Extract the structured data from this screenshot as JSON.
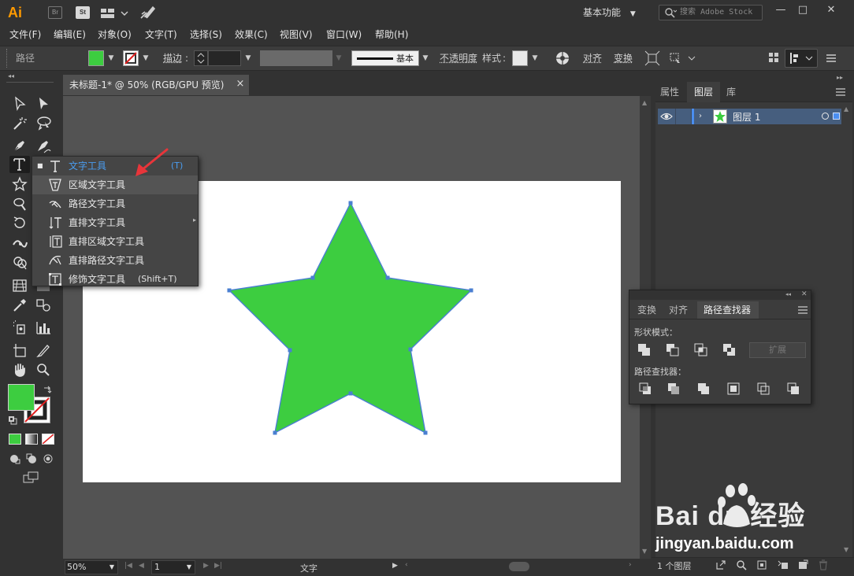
{
  "app": {
    "logo": "Ai",
    "badges": [
      "Br",
      "St"
    ],
    "workspace": "基本功能",
    "search_placeholder": "搜索 Adobe Stock",
    "window_controls": [
      "minimize-icon",
      "maximize-icon",
      "close-icon"
    ]
  },
  "menu": [
    "文件(F)",
    "编辑(E)",
    "对象(O)",
    "文字(T)",
    "选择(S)",
    "效果(C)",
    "视图(V)",
    "窗口(W)",
    "帮助(H)"
  ],
  "control_bar": {
    "object_label": "路径",
    "stroke_label": "描边",
    "stroke_value": "",
    "profile_label": "基本",
    "opacity_label": "不透明度",
    "style_label": "样式",
    "align_label": "对齐",
    "transform_label": "变换",
    "fill_color": "#3dcd40",
    "stroke_color": "none"
  },
  "document": {
    "tab_title": "未标题-1* @ 50% (RGB/GPU 预览)",
    "close_glyph": "×"
  },
  "artwork": {
    "shape": "star",
    "fill_color": "#3dcd40",
    "outline_color": "#4a7fd1"
  },
  "toolbar": {
    "fill_color": "#3dcd40",
    "stroke_color": "none"
  },
  "flyout": {
    "items": [
      {
        "label": "文字工具",
        "shortcut": "(T)",
        "icon": "type-tool-icon",
        "current": true
      },
      {
        "label": "区域文字工具",
        "shortcut": "",
        "icon": "area-type-tool-icon",
        "hover": true
      },
      {
        "label": "路径文字工具",
        "shortcut": "",
        "icon": "type-on-path-tool-icon"
      },
      {
        "label": "直排文字工具",
        "shortcut": "",
        "icon": "vertical-type-tool-icon"
      },
      {
        "label": "直排区域文字工具",
        "shortcut": "",
        "icon": "vertical-area-type-tool-icon"
      },
      {
        "label": "直排路径文字工具",
        "shortcut": "",
        "icon": "vertical-type-on-path-tool-icon"
      },
      {
        "label": "修饰文字工具",
        "shortcut": "(Shift+T)",
        "icon": "touch-type-tool-icon"
      }
    ],
    "current_bullet": "■",
    "current_color": "#4a9df0",
    "arrow_color": "#e8353a"
  },
  "layers_panel": {
    "tabs": [
      "属性",
      "图层",
      "库"
    ],
    "active_tab": "图层",
    "layer_name": "图层 1",
    "layer_count": "1 个图层"
  },
  "pathfinder_panel": {
    "tabs": [
      "变换",
      "对齐",
      "路径查找器"
    ],
    "active_tab": "路径查找器",
    "shape_modes_label": "形状模式：",
    "pathfinders_label": "路径查找器：",
    "expand_label": "扩展"
  },
  "status_bar": {
    "zoom": "50%",
    "artboard": "1",
    "tool_name": "文字"
  },
  "watermark": {
    "brand": "Bai du 经验",
    "url": "jingyan.baidu.com"
  }
}
